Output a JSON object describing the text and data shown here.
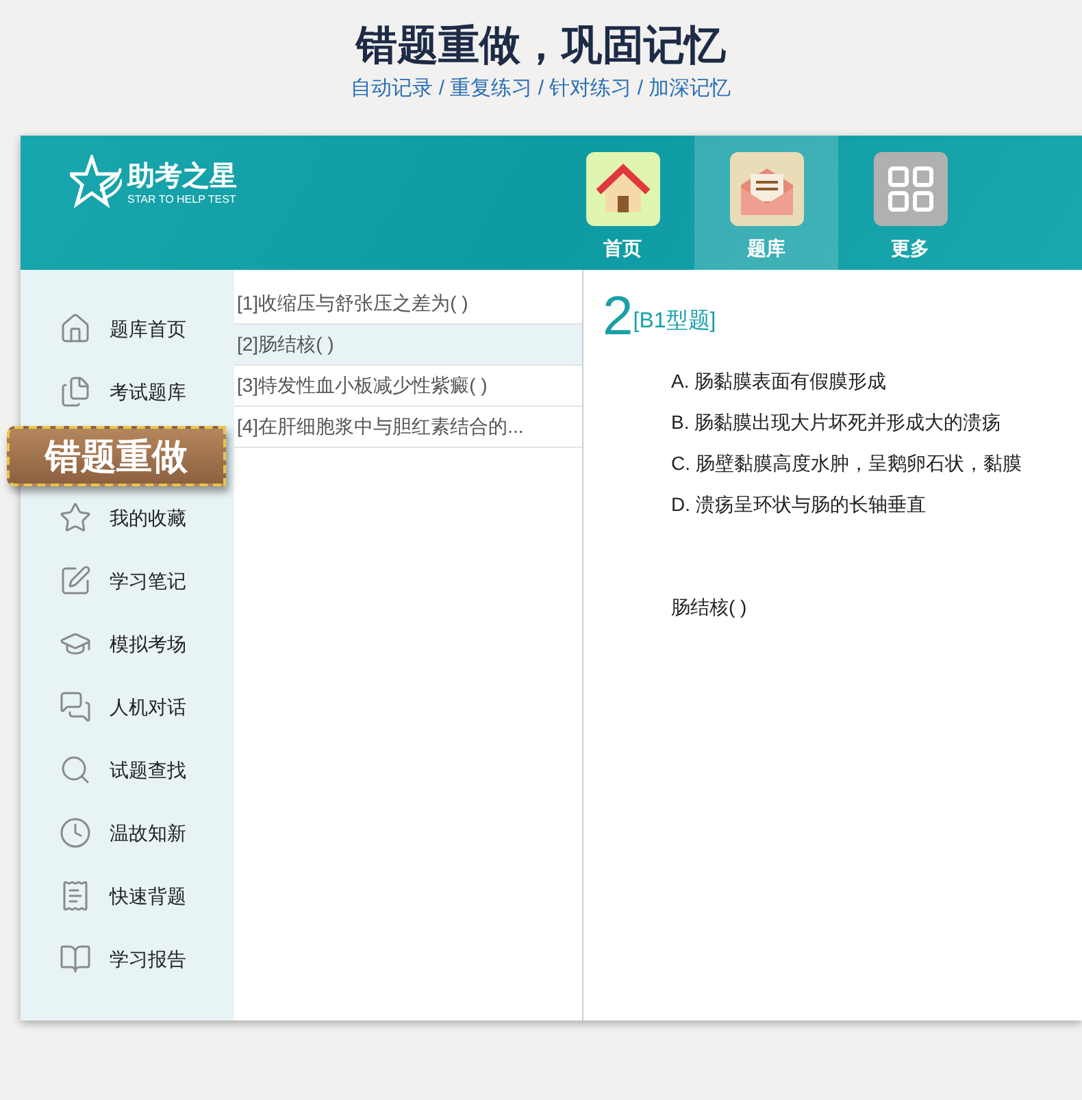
{
  "heading": {
    "title": "错题重做，巩固记忆",
    "subtitle": "自动记录 / 重复练习 / 针对练习 / 加深记忆"
  },
  "logo": {
    "name": "助考之星",
    "tagline": "STAR TO HELP TEST"
  },
  "nav": [
    {
      "label": "首页",
      "selected": false
    },
    {
      "label": "题库",
      "selected": true
    },
    {
      "label": "更多",
      "selected": false
    }
  ],
  "sidebar": {
    "items": [
      {
        "label": "题库首页"
      },
      {
        "label": "考试题库"
      },
      {
        "label": "我的收藏"
      },
      {
        "label": "学习笔记"
      },
      {
        "label": "模拟考场"
      },
      {
        "label": "人机对话"
      },
      {
        "label": "试题查找"
      },
      {
        "label": "温故知新"
      },
      {
        "label": "快速背题"
      },
      {
        "label": "学习报告"
      }
    ]
  },
  "ribbon": {
    "label": "错题重做"
  },
  "question_list": [
    {
      "label": "[1]收缩压与舒张压之差为(  )",
      "selected": false
    },
    {
      "label": "[2]肠结核(  )",
      "selected": true
    },
    {
      "label": "[3]特发性血小板减少性紫癜(  )",
      "selected": false
    },
    {
      "label": "[4]在肝细胞浆中与胆红素结合的...",
      "selected": false
    }
  ],
  "question": {
    "number": "2",
    "type": "[B1型题]",
    "options": [
      "A. 肠黏膜表面有假膜形成",
      "B. 肠黏膜出现大片坏死并形成大的溃疡",
      "C. 肠壁黏膜高度水肿，呈鹅卵石状，黏膜",
      "D. 溃疡呈环状与肠的长轴垂直"
    ],
    "stem": "肠结核(  )"
  }
}
